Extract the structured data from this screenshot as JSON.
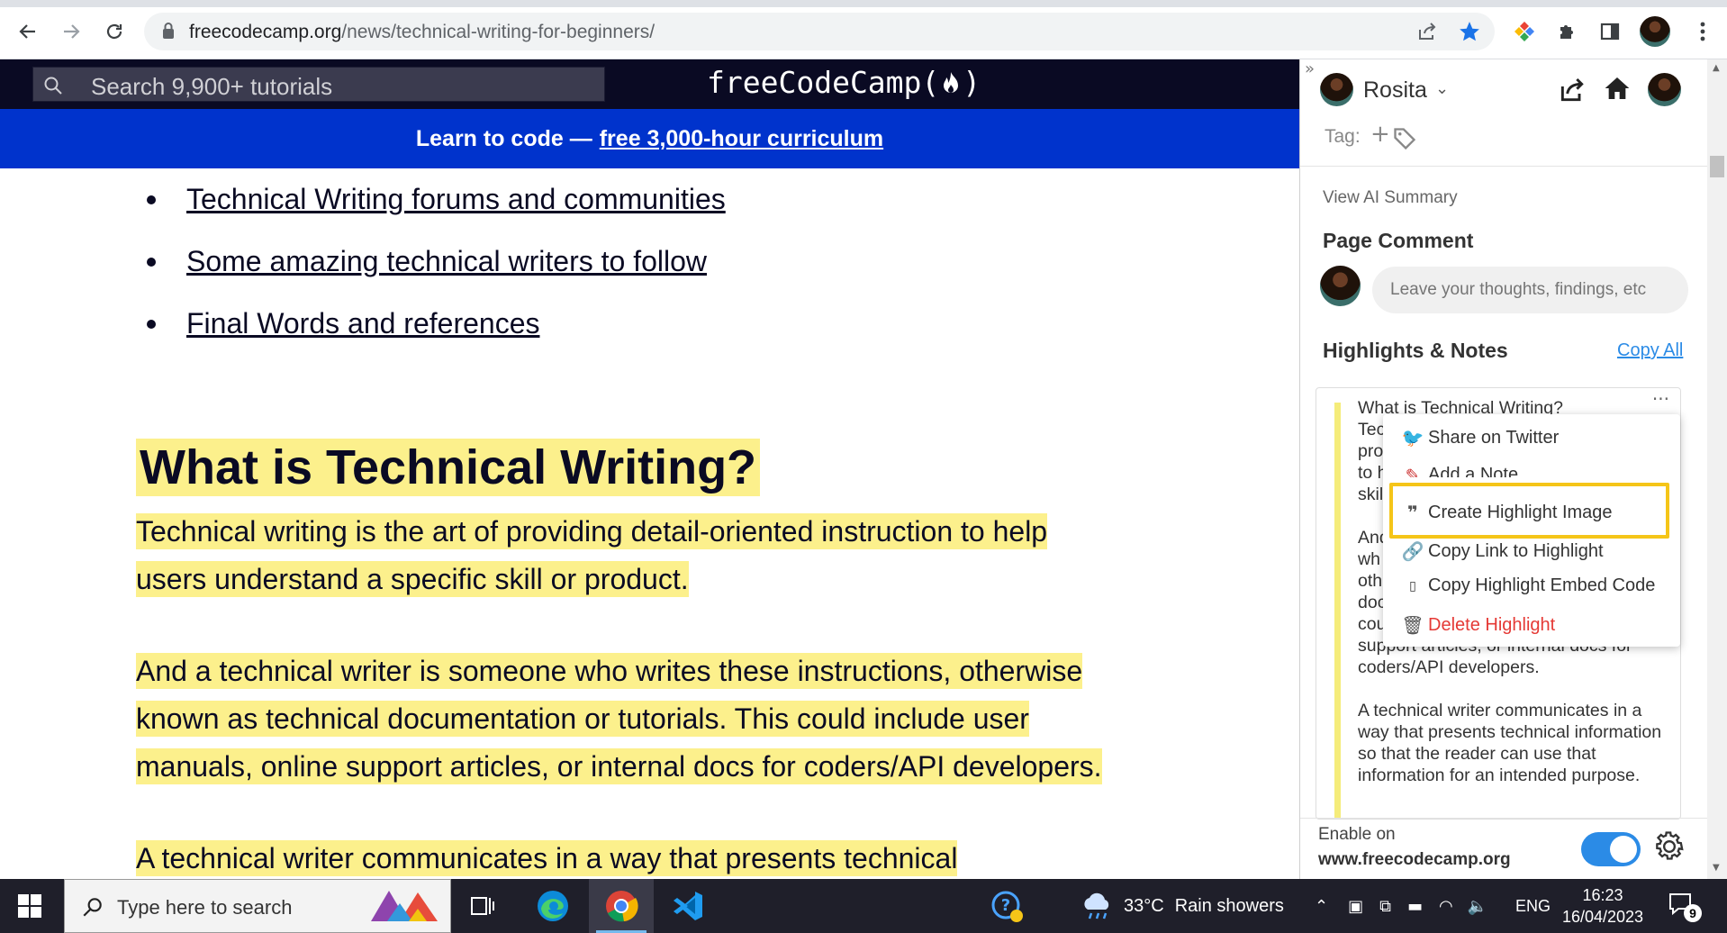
{
  "browser": {
    "url_host": "freecodecamp.org",
    "url_path": "/news/technical-writing-for-beginners/",
    "icons": [
      "back-icon",
      "forward-icon",
      "reload-icon",
      "lock-icon",
      "share-icon",
      "star-icon",
      "extension-colorful-icon",
      "puzzle-icon",
      "sidepanel-icon",
      "profile-avatar",
      "kebab-icon"
    ]
  },
  "fcc": {
    "search_placeholder": "Search 9,900+ tutorials",
    "logo": "freeCodeCamp(🔥)",
    "logo_text": "freeCodeCamp(",
    "logo_close": ")",
    "banner_prefix": "Learn to code —",
    "banner_link": "free 3,000-hour curriculum"
  },
  "article": {
    "toc": [
      "Technical Writing forums and communities",
      "Some amazing technical writers to follow",
      "Final Words and references"
    ],
    "heading": "What is Technical Writing?",
    "para1_line1": "Technical writing is the art of providing detail-oriented instruction to help",
    "para1_line2": "users understand a specific skill or product.",
    "para2_line1": "And a technical writer is someone who writes these instructions, otherwise",
    "para2_line2": "known as technical documentation or tutorials. This could include user",
    "para2_line3": "manuals, online support articles, or internal docs for coders/API developers.",
    "para3_line1": "A technical writer communicates in a way that presents technical"
  },
  "panel": {
    "user_name": "Rosita",
    "tag_label": "Tag:",
    "tag_add": "+",
    "view_ai_summary": "View AI Summary",
    "page_comment_title": "Page Comment",
    "comment_placeholder": "Leave your thoughts, findings, etc",
    "highlights_title": "Highlights & Notes",
    "copy_all": "Copy All",
    "highlight_lines": {
      "l1": "What is Technical Writing?",
      "l2": "Tec",
      "l3": "pro",
      "l4": "to h",
      "l5": "skil",
      "l6": "And",
      "l7": "wh",
      "l8": "oth",
      "l9": "doc",
      "l10": "cou",
      "l11": "support articles, or internal docs for",
      "l12": "coders/API developers.",
      "p3": "A technical writer communicates in a way that presents technical information so that the reader can use that information for an intended purpose."
    },
    "enable_label": "Enable on",
    "enable_domain": "www.freecodecamp.org",
    "toggle_on": true
  },
  "menu": {
    "share_twitter": "Share on Twitter",
    "add_note": "Add a Note",
    "create_image": "Create Highlight Image",
    "copy_link": "Copy Link to Highlight",
    "copy_embed": "Copy Highlight Embed Code",
    "delete": "Delete Highlight"
  },
  "taskbar": {
    "search_placeholder": "Type here to search",
    "weather_temp": "33°C",
    "weather_desc": "Rain showers",
    "lang": "ENG",
    "time": "16:23",
    "date": "16/04/2023",
    "notif_count": "9"
  },
  "colors": {
    "highlight": "#fcf08c",
    "fcc_nav": "#0a0a23",
    "fcc_banner": "#0033cc",
    "accent_blue": "#2b8be6",
    "delete_red": "#e53935",
    "focus_box": "#f5c518"
  }
}
